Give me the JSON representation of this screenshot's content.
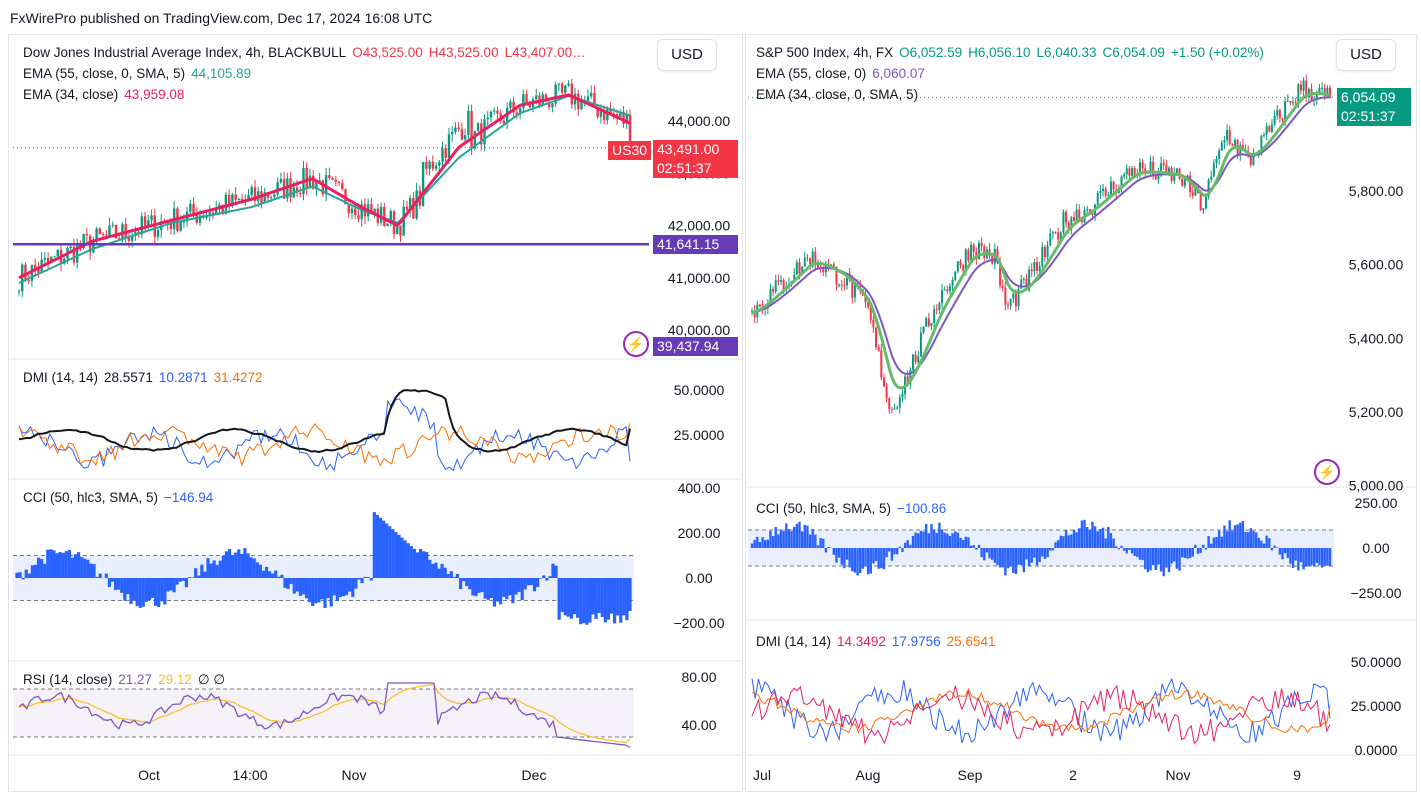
{
  "header": "FxWirePro published on TradingView.com, Dec 17, 2024 16:08 UTC",
  "colors": {
    "up": "#089981",
    "down": "#f23645",
    "ema_red": "#e91e63",
    "ema_teal": "#26a69a",
    "ema_green": "#66bb6a",
    "ema_purple": "#7e57c2",
    "line_purple": "#673ab7",
    "blue": "#2962ff",
    "orange": "#ff6d00",
    "black": "#131722",
    "rsi_yellow": "#fbc02d",
    "rsi_purple": "#7e57c2"
  },
  "left": {
    "currency": "USD",
    "legend_main": {
      "name": "Dow Jones Industrial Average Index, 4h, BLACKBULL",
      "o": "O43,525.00",
      "h": "H43,525.00",
      "l": "L43,407.00…"
    },
    "legend_ema1": {
      "name": "EMA (55, close, 0, SMA, 5)",
      "value": "44,105.89"
    },
    "legend_ema2": {
      "name": "EMA (34, close)",
      "value": "43,959.08"
    },
    "price_tag": {
      "symbol": "US30",
      "price": "43,491.00",
      "countdown": "02:51:37"
    },
    "level_tag": "41,641.15",
    "low_tag": "39,437.94",
    "dmi_legend": {
      "name": "DMI (14, 14)",
      "v1": "28.5571",
      "v2": "10.2871",
      "v3": "31.4272"
    },
    "cci_legend": {
      "name": "CCI (50, hlc3, SMA, 5)",
      "v1": "−146.94"
    },
    "rsi_legend": {
      "name": "RSI (14, close)",
      "v1": "21.27",
      "v2": "29.12",
      "v3": "∅ ∅"
    },
    "x_ticks": [
      "Oct",
      "14:00",
      "Nov",
      "Dec"
    ]
  },
  "right": {
    "currency": "USD",
    "legend_main": {
      "name": "S&P 500 Index, 4h, FX",
      "o": "O6,052.59",
      "h": "H6,056.10",
      "l": "L6,040.33",
      "c": "C6,054.09",
      "chg": "+1.50 (+0.02%)"
    },
    "legend_ema1": {
      "name": "EMA (55, close, 0)",
      "value": "6,060.07"
    },
    "legend_ema2": {
      "name": "EMA (34, close, 0, SMA, 5)"
    },
    "price_tag": {
      "price": "6,054.09",
      "countdown": "02:51:37"
    },
    "cci_legend": {
      "name": "CCI (50, hlc3, SMA, 5)",
      "v1": "−100.86"
    },
    "dmi_legend": {
      "name": "DMI (14, 14)",
      "v1": "14.3492",
      "v2": "17.9756",
      "v3": "25.6541"
    },
    "x_ticks": [
      "Jul",
      "Aug",
      "Sep",
      "2",
      "Nov",
      "9"
    ]
  },
  "chart_data": [
    {
      "type": "candlestick",
      "title": "Dow Jones Industrial Average Index, 4h, BLACKBULL",
      "y_ticks": [
        "44,000.00",
        "43,000.00",
        "42,000.00",
        "41,000.00",
        "40,000.00"
      ],
      "ylim": [
        39437.94,
        44987.0
      ],
      "horizontal_level": 41641.15,
      "last_price": 43491.0,
      "x_ticks": [
        "Oct",
        "14:00",
        "Nov",
        "Dec"
      ],
      "series_approx": [
        {
          "name": "EMA (34, close)",
          "points": [
            [
              0,
              41000
            ],
            [
              0.12,
              41700
            ],
            [
              0.25,
              42100
            ],
            [
              0.38,
              42500
            ],
            [
              0.48,
              42900
            ],
            [
              0.56,
              42350
            ],
            [
              0.62,
              42000
            ],
            [
              0.72,
              43500
            ],
            [
              0.82,
              44300
            ],
            [
              0.9,
              44500
            ],
            [
              1.0,
              43959
            ]
          ]
        },
        {
          "name": "EMA (55, close, 0, SMA, 5)",
          "points": [
            [
              0,
              40900
            ],
            [
              0.12,
              41550
            ],
            [
              0.25,
              42050
            ],
            [
              0.38,
              42350
            ],
            [
              0.48,
              42750
            ],
            [
              0.56,
              42300
            ],
            [
              0.62,
              42050
            ],
            [
              0.72,
              43300
            ],
            [
              0.82,
              44150
            ],
            [
              0.9,
              44480
            ],
            [
              1.0,
              44106
            ]
          ]
        }
      ]
    },
    {
      "type": "line",
      "title": "DMI (14, 14)",
      "y_ticks": [
        "50.0000",
        "25.0000"
      ],
      "ylim": [
        0,
        70
      ],
      "latest": {
        "adx": 28.5571,
        "di_plus": 10.2871,
        "di_minus": 31.4272
      }
    },
    {
      "type": "bar",
      "title": "CCI (50, hlc3, SMA, 5)",
      "y_ticks": [
        "400.00",
        "200.00",
        "0.00",
        "−200.00"
      ],
      "ylim": [
        -300,
        400
      ],
      "bands": [
        -100,
        100
      ],
      "latest": -146.94
    },
    {
      "type": "line",
      "title": "RSI (14, close)",
      "y_ticks": [
        "80.00",
        "40.00"
      ],
      "ylim": [
        20,
        90
      ],
      "bands": [
        30,
        70
      ],
      "latest": {
        "rsi": 21.27,
        "ma": 29.12
      }
    },
    {
      "type": "candlestick",
      "title": "S&P 500 Index, 4h, FX",
      "y_ticks": [
        "5,800.00",
        "5,600.00",
        "5,400.00",
        "5,200.00",
        "5,000.00"
      ],
      "ylim": [
        4990,
        6130
      ],
      "last_price": 6054.09,
      "x_ticks": [
        "Jul",
        "Aug",
        "Sep",
        "2",
        "Nov",
        "9"
      ]
    },
    {
      "type": "bar",
      "title": "CCI (50, hlc3, SMA, 5)",
      "y_ticks": [
        "250.00",
        "0.00",
        "−250.00"
      ],
      "ylim": [
        -350,
        300
      ],
      "bands": [
        -100,
        100
      ],
      "latest": -100.86
    },
    {
      "type": "line",
      "title": "DMI (14, 14)",
      "y_ticks": [
        "50.0000",
        "25.0000",
        "0.0000"
      ],
      "ylim": [
        -5,
        70
      ],
      "latest": {
        "adx": 25.6541,
        "di_plus": 17.9756,
        "di_minus": 14.3492
      }
    }
  ]
}
